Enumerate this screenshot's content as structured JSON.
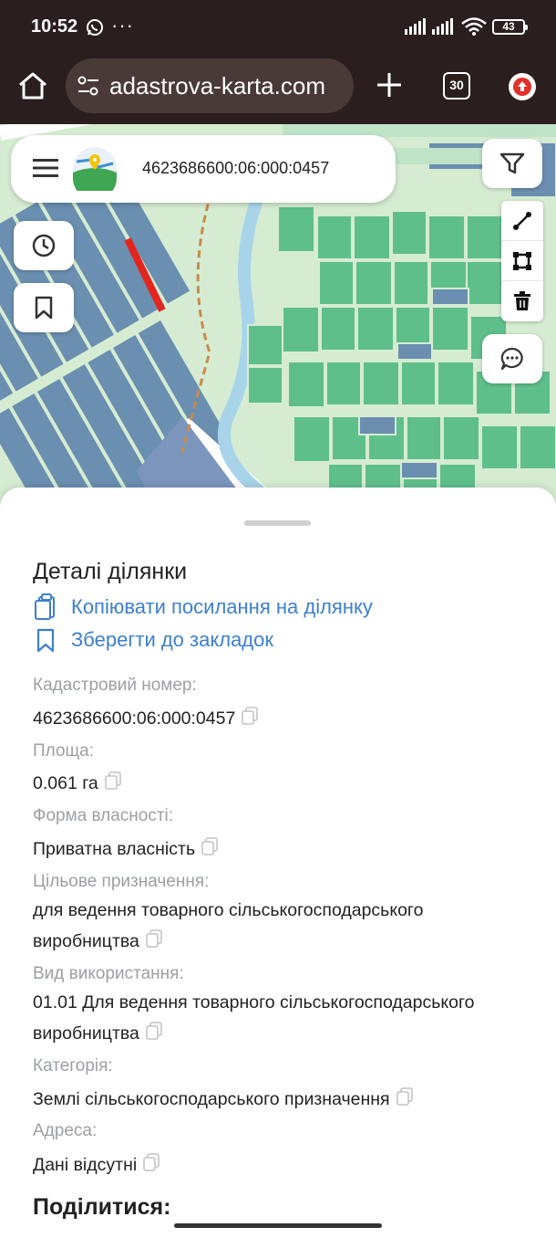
{
  "status_bar": {
    "time": "10:52",
    "more": "···",
    "battery": "43"
  },
  "browser": {
    "url": "adastrova-karta.com",
    "tab_count": "30"
  },
  "map": {
    "search_value": "4623686600:06:000:0457",
    "colors": {
      "parcel_green": "#5fbf8a",
      "parcel_blue": "#6a8fb0",
      "highlight": "#e3251f",
      "road": "#ffffff",
      "river": "#a8d4ea"
    }
  },
  "sheet": {
    "title": "Деталі ділянки",
    "actions": {
      "copy_link": "Копіювати посилання на ділянку",
      "save_bookmark": "Зберегти до закладок"
    },
    "fields": {
      "cadastral": {
        "label": "Кадастровий номер:",
        "value": "4623686600:06:000:0457"
      },
      "area": {
        "label": "Площа:",
        "value": "0.061 га"
      },
      "ownership": {
        "label": "Форма власності:",
        "value": "Приватна власність"
      },
      "purpose": {
        "label": "Цільове призначення:",
        "value": "для ведення товарного сільськогосподарського виробництва"
      },
      "usage": {
        "label": "Вид використання:",
        "value": "01.01 Для ведення товарного сільськогосподарського виробництва"
      },
      "category": {
        "label": "Категорія:",
        "value": "Землі сільськогосподарського призначення"
      },
      "address": {
        "label": "Адреса:",
        "value": "Дані відсутні"
      }
    },
    "share_title": "Поділитися:"
  }
}
